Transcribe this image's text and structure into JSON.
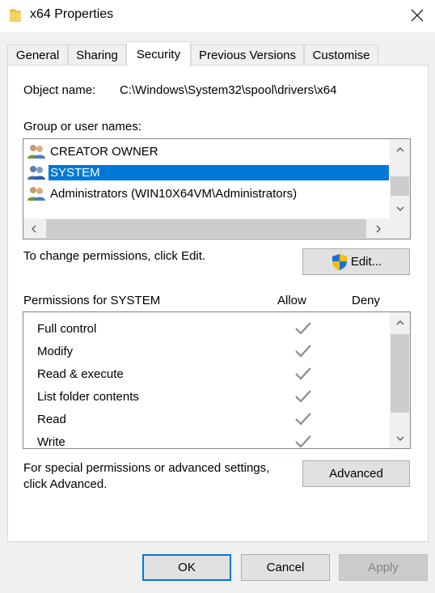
{
  "window": {
    "title": "x64 Properties",
    "icon": "folder-icon",
    "close_icon": "close-icon"
  },
  "tabs": [
    {
      "label": "General",
      "active": false
    },
    {
      "label": "Sharing",
      "active": false
    },
    {
      "label": "Security",
      "active": true
    },
    {
      "label": "Previous Versions",
      "active": false
    },
    {
      "label": "Customise",
      "active": false
    }
  ],
  "security": {
    "object_name_label": "Object name:",
    "object_name_value": "C:\\Windows\\System32\\spool\\drivers\\x64",
    "group_label": "Group or user names:",
    "groups": [
      {
        "name": "CREATOR OWNER",
        "selected": false
      },
      {
        "name": "SYSTEM",
        "selected": true
      },
      {
        "name": "Administrators (WIN10X64VM\\Administrators)",
        "selected": false
      }
    ],
    "change_text": "To change permissions, click Edit.",
    "edit_label": "Edit...",
    "permissions_label": "Permissions for SYSTEM",
    "allow_header": "Allow",
    "deny_header": "Deny",
    "permissions": [
      {
        "name": "Full control",
        "allow": true,
        "deny": false
      },
      {
        "name": "Modify",
        "allow": true,
        "deny": false
      },
      {
        "name": "Read & execute",
        "allow": true,
        "deny": false
      },
      {
        "name": "List folder contents",
        "allow": true,
        "deny": false
      },
      {
        "name": "Read",
        "allow": true,
        "deny": false
      },
      {
        "name": "Write",
        "allow": true,
        "deny": false
      }
    ],
    "special_text_line1": "For special permissions or advanced settings,",
    "special_text_line2": "click Advanced.",
    "advanced_label": "Advanced"
  },
  "footer": {
    "ok_label": "OK",
    "cancel_label": "Cancel",
    "apply_label": "Apply",
    "apply_enabled": false
  },
  "colors": {
    "selection": "#0078d7",
    "check_gray": "#8c8c8c",
    "shield_blue": "#1e6fd9",
    "shield_yellow": "#f2c200"
  }
}
